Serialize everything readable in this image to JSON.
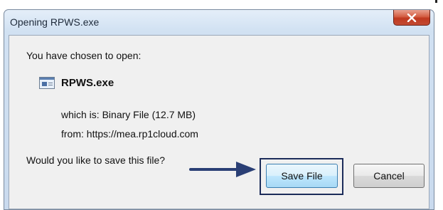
{
  "dialog": {
    "title": "Opening RPWS.exe",
    "close_icon": "close-x-icon",
    "prompt": "You have chosen to open:",
    "file": {
      "icon": "executable-file-icon",
      "name": "RPWS.exe",
      "which_label": "which is:",
      "type": "Binary File (12.7 MB)",
      "from_label": "from:",
      "source": "https://mea.rp1cloud.com"
    },
    "question": "Would you like to save this file?",
    "buttons": {
      "save": "Save File",
      "cancel": "Cancel"
    }
  },
  "annotation": {
    "arrow_icon": "right-arrow-icon",
    "arrow_color": "#2a3f75",
    "highlight_color": "#1c2c5a"
  },
  "colors": {
    "title_bar": "#d1e1f2",
    "close_button": "#c0391f",
    "content_bg": "#f0f0f0"
  }
}
